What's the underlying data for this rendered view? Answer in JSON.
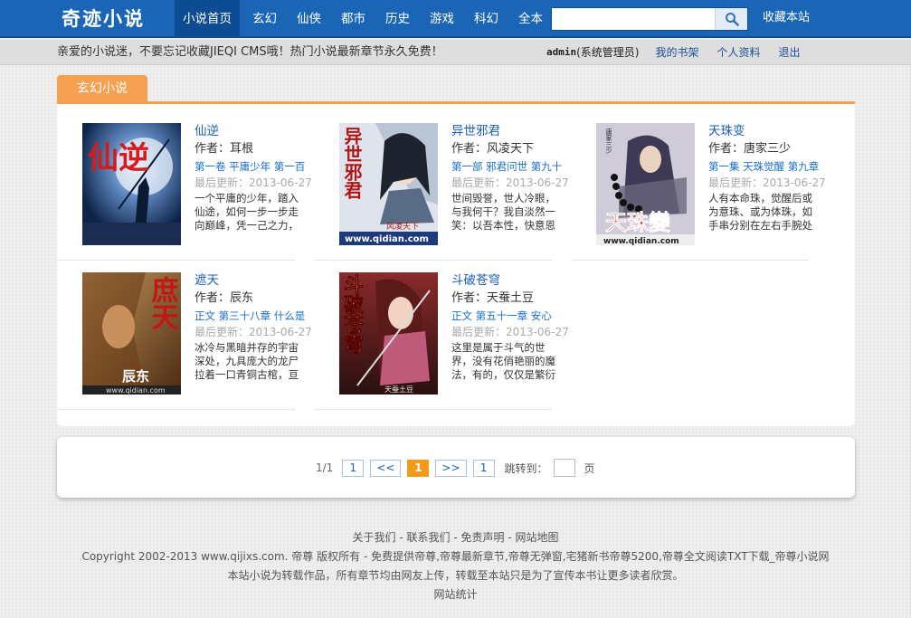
{
  "header": {
    "logo": "奇迹小说",
    "nav": [
      "小说首页",
      "玄幻",
      "仙侠",
      "都市",
      "历史",
      "游戏",
      "科幻",
      "全本"
    ],
    "active_index": 0,
    "search": {
      "value": "",
      "placeholder": ""
    },
    "favorite_label": "收藏本站"
  },
  "subbar": {
    "notice": "亲爱的小说迷，不要忘记收藏JIEQI CMS哦！热门小说最新章节永久免费！",
    "user_name": "admin",
    "user_role": "(系统管理员)",
    "links": [
      "我的书架",
      "个人资料",
      "退出"
    ]
  },
  "section": {
    "tab_label": "玄幻小说",
    "books": [
      {
        "title": "仙逆",
        "author": "作者：耳根",
        "chapter": "第一卷 平庸少年 第一百",
        "update": "最后更新：2013-06-27",
        "desc": "一个平庸的少年，踏入仙途，如何一步一步走向巅峰，凭一己之力，"
      },
      {
        "title": "异世邪君",
        "author": "作者：风凌天下",
        "chapter": "第一部 邪君问世 第九十",
        "update": "最后更新：2013-06-27",
        "desc": "世间毁誉，世人冷眼，与我何干？我自淡然一笑：以吾本性，快意恩"
      },
      {
        "title": "天珠变",
        "author": "作者：唐家三少",
        "chapter": "第一集 天珠觉醒 第九章",
        "update": "最后更新：2013-06-27",
        "desc": "人有本命珠，觉醒后或为意珠、或为体珠，如手串分别在左右手腕处"
      },
      {
        "title": "遮天",
        "author": "作者：辰东",
        "chapter": "正文 第三十八章 什么是",
        "update": "最后更新：2013-06-27",
        "desc": "冰冷与黑暗并存的宇宙深处，九具庞大的龙尸拉着一口青铜古棺，亘"
      },
      {
        "title": "斗破苍穹",
        "author": "作者：天蚕土豆",
        "chapter": "正文 第五十一章 安心",
        "update": "最后更新：2013-06-27",
        "desc": "这里是属于斗气的世界，没有花俏艳丽的魔法，有的，仅仅是繁衍"
      }
    ],
    "covers": [
      {
        "text": "仙逆",
        "bg": "#1b3f73",
        "text_color": "#d91a1a"
      },
      {
        "text": "异世邪君",
        "bg": "#d9dee6",
        "text_color": "#b01515",
        "footer": "www.qidian.com",
        "author_mark": "风凌天下"
      },
      {
        "text": "天珠變",
        "bg": "#c9c7d6",
        "text_color": "#d42020",
        "footer": "www.qidian.com",
        "author_mark": "唐家三少"
      },
      {
        "text": "庶天",
        "bg": "#8a5a2e",
        "text_color": "#c41515",
        "footer": "www.qidian.com",
        "author_mark": "辰东"
      },
      {
        "text": "斗破苍穹",
        "bg": "#6b2b2a",
        "text_color": "#f0d36a",
        "author_mark": "天蚕土豆"
      }
    ]
  },
  "pager": {
    "stat": "1/1",
    "first": "1",
    "prev": "<<",
    "current": "1",
    "next": ">>",
    "last": "1",
    "jump_label": "跳转到：",
    "jump_unit": "页"
  },
  "footer": {
    "links": [
      "关于我们",
      "联系我们",
      "免责声明",
      "网站地图"
    ],
    "separator": " - ",
    "copyright": "Copyright 2002-2013 www.qijixs.com. 帝尊 版权所有 - 免费提供帝尊,帝尊最新章节,帝尊无弹窗,宅猪新书帝尊5200,帝尊全文阅读TXT下载_帝尊小说网",
    "statement": "本站小说为转载作品，所有章节均由网友上传，转载至本站只是为了宣传本书让更多读者欣赏。",
    "stats": "网站统计"
  },
  "colors": {
    "nav_bg": "#1a65b5",
    "nav_active": "#0d4c92",
    "accent_orange": "#f7a052",
    "link_blue": "#1a5fb4",
    "pager_current": "#f49a1a"
  }
}
